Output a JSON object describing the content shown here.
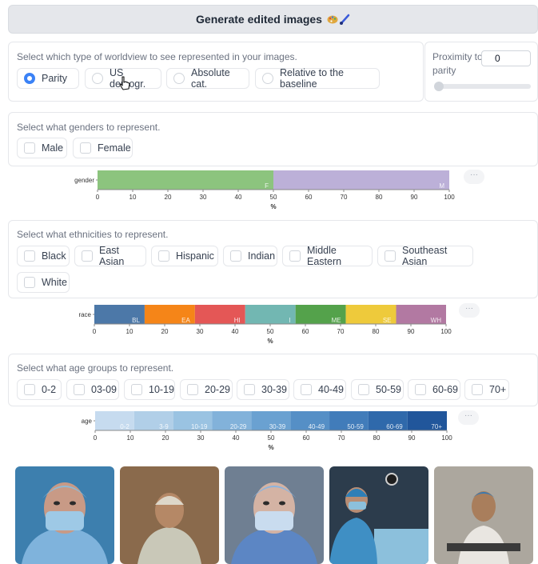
{
  "generate_button": {
    "label": "Generate edited images",
    "emoji_names": [
      "palette-icon",
      "paintbrush-icon"
    ]
  },
  "worldview": {
    "label": "Select which type of worldview to see represented in your images.",
    "options": [
      "Parity",
      "US demogr.",
      "Absolute cat.",
      "Relative to the baseline"
    ],
    "selected": "Parity",
    "proximity": {
      "label": "Proximity to parity",
      "value": "0",
      "slider_level": 0
    }
  },
  "genders": {
    "label": "Select what genders to represent.",
    "options": [
      "Male",
      "Female"
    ]
  },
  "ethnicities": {
    "label": "Select what ethnicities to represent.",
    "options": [
      "Black",
      "East Asian",
      "Hispanic",
      "Indian",
      "Middle Eastern",
      "Southeast Asian",
      "White"
    ]
  },
  "ages": {
    "label": "Select what age groups to represent.",
    "options": [
      "0-2",
      "03-09",
      "10-19",
      "20-29",
      "30-39",
      "40-49",
      "50-59",
      "60-69",
      "70+"
    ]
  },
  "more_button_label": "···",
  "chart_data": [
    {
      "type": "bar",
      "ylabel": "gender",
      "xlabel": "%",
      "xlim": [
        0,
        100
      ],
      "xticks": [
        0,
        10,
        20,
        30,
        40,
        50,
        60,
        70,
        80,
        90,
        100
      ],
      "segments": [
        {
          "label": "F",
          "value": 50,
          "color": "#8cc47e"
        },
        {
          "label": "M",
          "value": 50,
          "color": "#bcb0d8"
        }
      ]
    },
    {
      "type": "bar",
      "ylabel": "race",
      "xlabel": "%",
      "xlim": [
        0,
        100
      ],
      "xticks": [
        0,
        10,
        20,
        30,
        40,
        50,
        60,
        70,
        80,
        90,
        100
      ],
      "segments": [
        {
          "label": "BL",
          "value": 14.3,
          "color": "#4c78a8"
        },
        {
          "label": "EA",
          "value": 14.3,
          "color": "#f58518"
        },
        {
          "label": "HI",
          "value": 14.3,
          "color": "#e45756"
        },
        {
          "label": "I",
          "value": 14.3,
          "color": "#72b7b2"
        },
        {
          "label": "ME",
          "value": 14.3,
          "color": "#54a24b"
        },
        {
          "label": "SE",
          "value": 14.3,
          "color": "#eeca3b"
        },
        {
          "label": "WH",
          "value": 14.2,
          "color": "#b279a2"
        }
      ]
    },
    {
      "type": "bar",
      "ylabel": "age",
      "xlabel": "%",
      "xlim": [
        0,
        100
      ],
      "xticks": [
        0,
        10,
        20,
        30,
        40,
        50,
        60,
        70,
        80,
        90,
        100
      ],
      "segments": [
        {
          "label": "0-2",
          "value": 11.1,
          "color": "#c6dbef"
        },
        {
          "label": "3-9",
          "value": 11.1,
          "color": "#b1cfe8"
        },
        {
          "label": "10-19",
          "value": 11.1,
          "color": "#9ac3e2"
        },
        {
          "label": "20-29",
          "value": 11.1,
          "color": "#82b2da"
        },
        {
          "label": "30-39",
          "value": 11.1,
          "color": "#6aa1d1"
        },
        {
          "label": "40-49",
          "value": 11.1,
          "color": "#558fc6"
        },
        {
          "label": "50-59",
          "value": 11.1,
          "color": "#417cba"
        },
        {
          "label": "60-69",
          "value": 11.1,
          "color": "#2f69ab"
        },
        {
          "label": "70+",
          "value": 11.2,
          "color": "#21569b"
        }
      ]
    }
  ],
  "photos": [
    {
      "name": "surgeon-closeup-photo",
      "bg": "#3d7fae",
      "skin": "#c89a86",
      "cap": "#8fbad6",
      "mask": "#9ec9e6",
      "gown": "#7fb3dc"
    },
    {
      "name": "surgeon-back-photo",
      "bg": "#8a6a4c",
      "skin": "#b58866",
      "cap": "#ddd7c9",
      "mask": "#ddd7c9",
      "gown": "#c9c8b8"
    },
    {
      "name": "surgeon-masked-photo",
      "bg": "#6f7f92",
      "skin": "#d4b3a4",
      "cap": "#8ab4e0",
      "mask": "#c9dcef",
      "gown": "#5c86c4"
    },
    {
      "name": "surgeon-operating-photo",
      "bg": "#2c3c4c",
      "skin": "#b88d74",
      "cap": "#2f7fb6",
      "mask": "#8cc0dc",
      "gown": "#3f8fc4"
    },
    {
      "name": "elderly-patient-photo",
      "bg": "#a39f96",
      "skin": "#a97e5c",
      "cap": "#3a7ab2",
      "mask": "#a97e5c",
      "gown": "#e9e6e1"
    }
  ]
}
